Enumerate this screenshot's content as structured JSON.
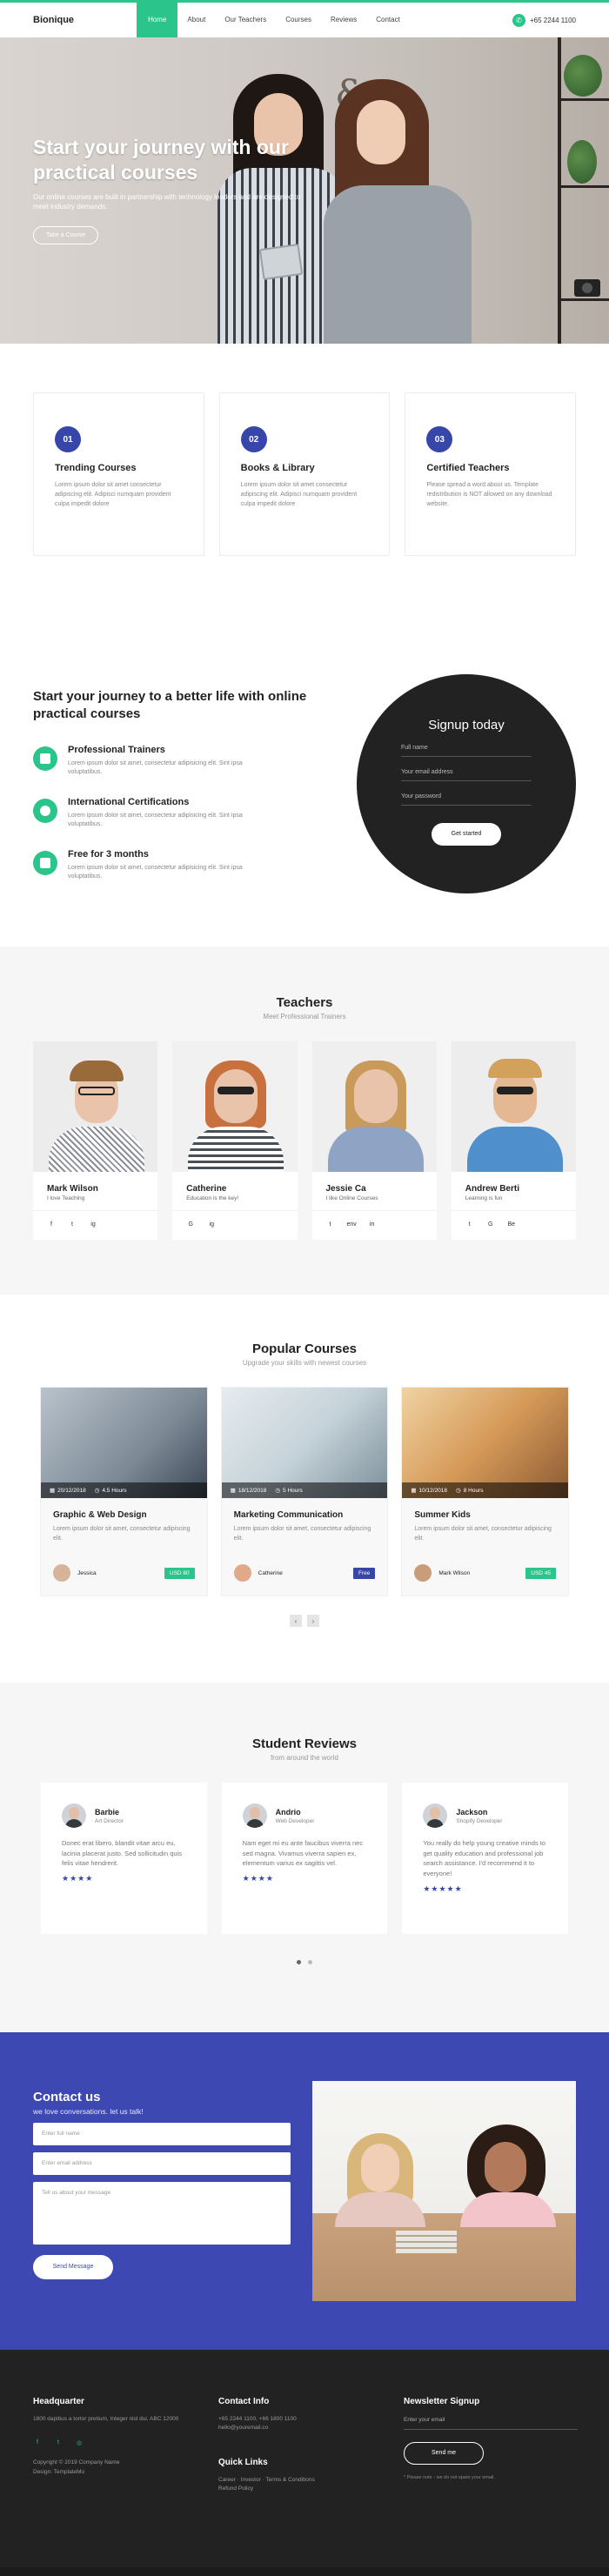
{
  "header": {
    "brand": "Bionique",
    "nav": [
      "Home",
      "About",
      "Our Teachers",
      "Courses",
      "Reviews",
      "Contact"
    ],
    "phone": "+65 2244 1100",
    "phone_icon": "phone-icon"
  },
  "hero": {
    "title": "Start your journey with our practical courses",
    "description": "Our online courses are built in partnership with technology leaders and are designed to meet industry demands.",
    "button": "Take a Course"
  },
  "features": [
    {
      "num": "01",
      "title": "Trending Courses",
      "desc": "Lorem ipsum dolor sit amet consectetur adipiscing elit. Adipisci numquam provident culpa impedit dolore"
    },
    {
      "num": "02",
      "title": "Books & Library",
      "desc": "Lorem ipsum dolor sit amet consectetur adipiscing elit. Adipisci numquam provident culpa impedit dolore"
    },
    {
      "num": "03",
      "title": "Certified Teachers",
      "desc": "Please spread a word about us. Template redistribution is NOT allowed on any download website."
    }
  ],
  "journey": {
    "title": "Start your journey to a better life with online practical courses",
    "items": [
      {
        "title": "Professional Trainers",
        "desc": "Lorem ipsum dolor sit amet, consectetur adipisicing elit. Sint ipsa voluptatibus."
      },
      {
        "title": "International Certifications",
        "desc": "Lorem ipsum dolor sit amet, consectetur adipisicing elit. Sint ipsa voluptatibus."
      },
      {
        "title": "Free for 3 months",
        "desc": "Lorem ipsum dolor sit amet, consectetur adipisicing elit. Sint ipsa voluptatibus."
      }
    ]
  },
  "signup": {
    "title": "Signup today",
    "fields": [
      "Full name",
      "Your email address",
      "Your password"
    ],
    "button": "Get started"
  },
  "teachers": {
    "title": "Teachers",
    "subtitle": "Meet Professional Trainers",
    "items": [
      {
        "name": "Mark Wilson",
        "role": "I love Teaching",
        "social": [
          "f",
          "t",
          "ig"
        ]
      },
      {
        "name": "Catherine",
        "role": "Education is the key!",
        "social": [
          "G",
          "ig"
        ]
      },
      {
        "name": "Jessie Ca",
        "role": "I like Online Courses",
        "social": [
          "t",
          "env",
          "in"
        ]
      },
      {
        "name": "Andrew Berti",
        "role": "Learning is fun",
        "social": [
          "t",
          "G",
          "Be"
        ]
      }
    ]
  },
  "courses": {
    "title": "Popular Courses",
    "subtitle": "Upgrade your skills with newest courses",
    "items": [
      {
        "date": "20/12/2018",
        "hours": "4.5 Hours",
        "title": "Graphic & Web Design",
        "desc": "Lorem ipsum dolor sit amet, consectetur adipiscing elit.",
        "author": "Jessica",
        "price": "USD 80"
      },
      {
        "date": "18/12/2018",
        "hours": "5 Hours",
        "title": "Marketing Communication",
        "desc": "Lorem ipsum dolor sit amet, consectetur adipiscing elit.",
        "author": "Catherine",
        "price": "Free"
      },
      {
        "date": "10/12/2018",
        "hours": "8 Hours",
        "title": "Summer Kids",
        "desc": "Lorem ipsum dolor sit amet, consectetur adipiscing elit.",
        "author": "Mark Wilson",
        "price": "USD 45"
      }
    ],
    "pager_prev": "‹",
    "pager_next": "›"
  },
  "reviews": {
    "title": "Student Reviews",
    "subtitle": "from around the world",
    "items": [
      {
        "name": "Barbie",
        "role": "Art Director",
        "text": "Donec erat libero, blandit vitae arcu eu, lacinia placerat justo. Sed sollicitudin quis felis vitae hendrerit.",
        "stars": "★★★★"
      },
      {
        "name": "Andrio",
        "role": "Web Developer",
        "text": "Nam eget mi eu ante faucibus viverra nec sed magna. Vivamus viverra sapien ex, elementum varius ex sagittis vel.",
        "stars": "★★★★"
      },
      {
        "name": "Jackson",
        "role": "Shopify Developer",
        "text": "You really do help young creative minds to get quality education and professional job search assistance. I'd recommend it to everyone!",
        "stars": "★★★★★"
      }
    ]
  },
  "contact": {
    "title": "Contact us",
    "subtitle": "we love conversations. let us talk!",
    "name_placeholder": "Enter full name",
    "email_placeholder": "Enter email address",
    "message_placeholder": "Tell us about your message",
    "button": "Send Message"
  },
  "footer": {
    "hq_title": "Headquarter",
    "hq_address": "1800 dapibus a tortor pretium, Integer nisl dui, ABC 12000",
    "copyright": "Copyright © 2019 Company Name",
    "design": "Design: TemplateMo",
    "contact_title": "Contact Info",
    "contact_phone": "+65 2244 1100, +66 1800 1100",
    "contact_email": "hello@youremail.co",
    "quick_title": "Quick Links",
    "quick_links": "Career · Investor · Terms & Conditions",
    "quick_links2": "Refund Policy",
    "newsletter_title": "Newsletter Signup",
    "newsletter_placeholder": "Enter your email",
    "newsletter_button": "Send me",
    "newsletter_note": "* Please note - we do not spam your email."
  },
  "colors": {
    "accent": "#2bc48a",
    "primary": "#3646a9",
    "contact_bg": "#3d48b3",
    "dark": "#222222"
  }
}
